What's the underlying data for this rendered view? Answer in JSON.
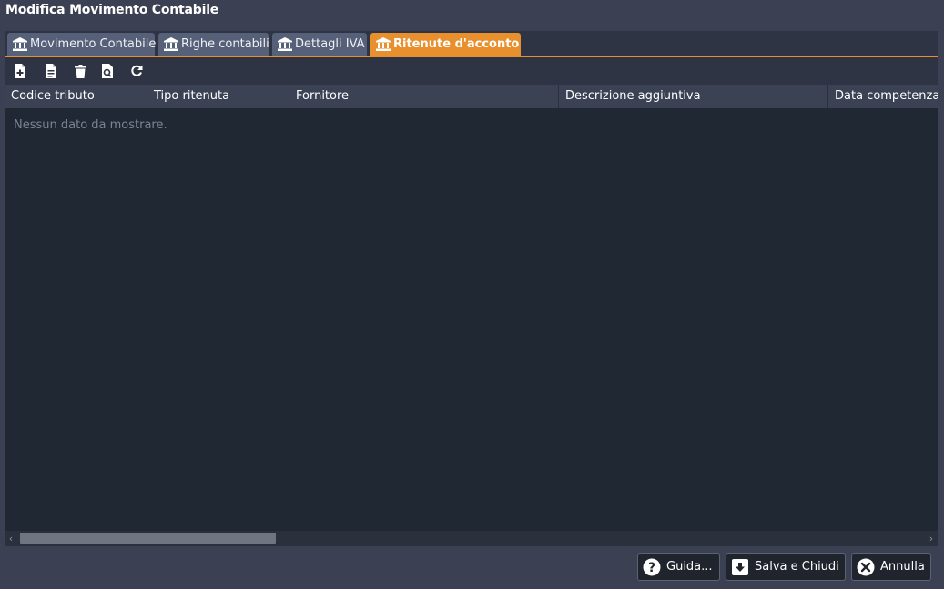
{
  "window": {
    "title": "Modifica Movimento Contabile"
  },
  "tabs": [
    {
      "label": "Movimento Contabile",
      "icon": "bank-icon",
      "active": false
    },
    {
      "label": "Righe contabili",
      "icon": "bank-icon",
      "active": false
    },
    {
      "label": "Dettagli IVA",
      "icon": "bank-icon",
      "active": false
    },
    {
      "label": "Ritenute d'acconto",
      "icon": "bank-icon",
      "active": true
    }
  ],
  "toolbar": {
    "buttons": [
      {
        "name": "new",
        "icon": "file-plus-icon"
      },
      {
        "name": "edit",
        "icon": "file-text-icon"
      },
      {
        "name": "delete",
        "icon": "trash-icon"
      },
      {
        "name": "view",
        "icon": "file-search-icon"
      },
      {
        "name": "refresh",
        "icon": "refresh-icon"
      }
    ]
  },
  "grid": {
    "columns": [
      "Codice tributo",
      "Tipo ritenuta",
      "Fornitore",
      "Descrizione aggiuntiva",
      "Data competenza"
    ],
    "rows": [],
    "empty_text": "Nessun dato da mostrare."
  },
  "footer": {
    "help_label": "Guida...",
    "save_label": "Salva e Chiudi",
    "cancel_label": "Annulla"
  },
  "colors": {
    "accent": "#e8902e",
    "background": "#3b4152",
    "grid_background": "#202833",
    "tab_inactive": "#566078"
  }
}
